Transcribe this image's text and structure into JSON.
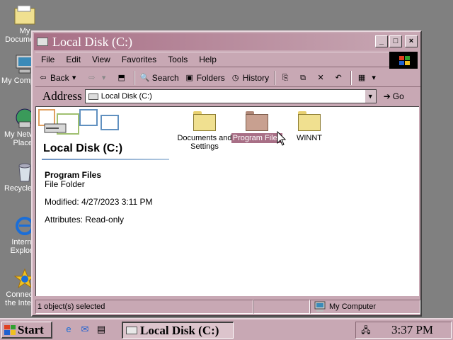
{
  "desktop": {
    "icons": [
      {
        "label": "My Documents",
        "icon": "folder-icon"
      },
      {
        "label": "My Computer",
        "icon": "computer-icon"
      },
      {
        "label": "My Network Places",
        "icon": "network-icon"
      },
      {
        "label": "Recycle Bin",
        "icon": "recycle-bin-icon"
      },
      {
        "label": "Internet Explorer",
        "icon": "ie-icon"
      },
      {
        "label": "Connect to the Internet",
        "icon": "connect-icon"
      }
    ]
  },
  "window": {
    "title": "Local Disk (C:)",
    "menu": [
      "File",
      "Edit",
      "View",
      "Favorites",
      "Tools",
      "Help"
    ],
    "toolbar": {
      "back": "Back",
      "search": "Search",
      "folders": "Folders",
      "history": "History"
    },
    "address": {
      "label": "Address",
      "value": "Local Disk (C:)",
      "go": "Go"
    },
    "panel": {
      "title": "Local Disk (C:)",
      "selected_name": "Program Files",
      "selected_type": "File Folder",
      "modified": "Modified: 4/27/2023 3:11 PM",
      "attributes": "Attributes: Read-only"
    },
    "folders": [
      {
        "name": "Documents and Settings",
        "selected": false
      },
      {
        "name": "Program Files",
        "selected": true
      },
      {
        "name": "WINNT",
        "selected": false
      }
    ],
    "status": {
      "selection": "1 object(s) selected",
      "location": "My Computer"
    }
  },
  "taskbar": {
    "start": "Start",
    "task": "Local Disk (C:)",
    "clock": "3:37 PM"
  },
  "colors": {
    "accent": "#a86f86",
    "chrome": "#c8a8b4",
    "desktop": "#808080",
    "folder": "#f0e090",
    "folder_selected": "#c8a090"
  }
}
